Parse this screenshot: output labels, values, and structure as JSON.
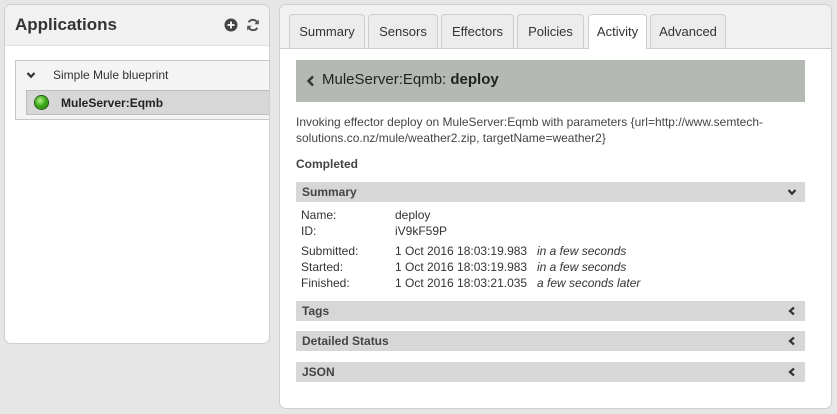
{
  "sidebar": {
    "title": "Applications",
    "tree": {
      "app_label": "Simple Mule blueprint",
      "entity_label": "MuleServer:Eqmb"
    }
  },
  "tabs": [
    {
      "label": "Summary"
    },
    {
      "label": "Sensors"
    },
    {
      "label": "Effectors"
    },
    {
      "label": "Policies"
    },
    {
      "label": "Activity",
      "active": true
    },
    {
      "label": "Advanced"
    }
  ],
  "task": {
    "entity": "MuleServer:Eqmb:",
    "name": "deploy",
    "description": "Invoking effector deploy on MuleServer:Eqmb with parameters {url=http://www.semtech-solutions.co.nz/mule/weather2.zip, targetName=weather2}",
    "status": "Completed",
    "summary_label": "Summary",
    "fields": {
      "name_key": "Name:",
      "name_val": "deploy",
      "id_key": "ID:",
      "id_val": "iV9kF59P",
      "submitted_key": "Submitted:",
      "submitted_val": "1 Oct 2016 18:03:19.983",
      "submitted_rel": "in a few seconds",
      "started_key": "Started:",
      "started_val": "1 Oct 2016 18:03:19.983",
      "started_rel": "in a few seconds",
      "finished_key": "Finished:",
      "finished_val": "1 Oct 2016 18:03:21.035",
      "finished_rel": "a few seconds later"
    },
    "sections": {
      "tags": "Tags",
      "detailed_status": "Detailed Status",
      "json": "JSON"
    }
  },
  "colors": {
    "title_bar": "#b4b9b4",
    "section_bar": "#d7d7d7",
    "status_running": "#3fae1c"
  }
}
